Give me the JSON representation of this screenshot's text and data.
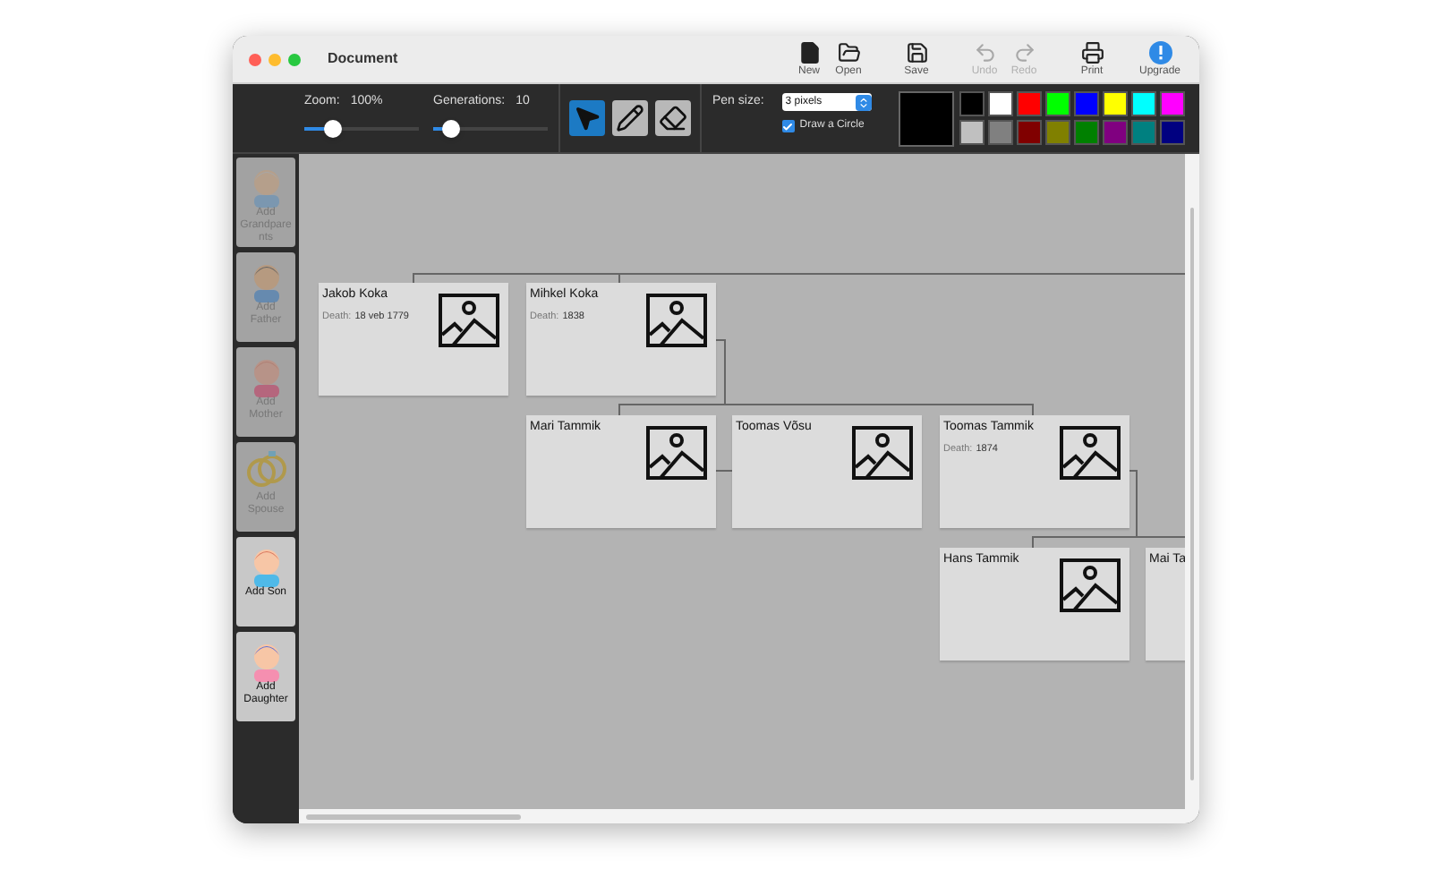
{
  "window": {
    "title": "Document"
  },
  "toolbar_buttons": [
    {
      "kind": "new",
      "label": "New",
      "disabled": false
    },
    {
      "kind": "open",
      "label": "Open",
      "disabled": false
    },
    {
      "kind": "save",
      "label": "Save",
      "disabled": false
    },
    {
      "kind": "undo",
      "label": "Undo",
      "disabled": true
    },
    {
      "kind": "redo",
      "label": "Redo",
      "disabled": true
    },
    {
      "kind": "print",
      "label": "Print",
      "disabled": false
    },
    {
      "kind": "upgrade",
      "label": "Upgrade",
      "disabled": false
    }
  ],
  "sliders": [
    {
      "label": "Zoom:",
      "reading": "100%",
      "level": 0.25
    },
    {
      "label": "Generations:",
      "reading": "10",
      "level": 0.15
    }
  ],
  "tools": [
    {
      "kind": "pointer",
      "selected": true
    },
    {
      "kind": "pencil",
      "selected": false
    },
    {
      "kind": "eraser",
      "selected": false
    }
  ],
  "pen_size": {
    "label": "Pen size:",
    "value": "3 pixels"
  },
  "draw_circle": {
    "label": "Draw a Circle",
    "checked": true
  },
  "current_swatch": {
    "color": "#000000"
  },
  "palette": [
    {
      "color": "#000000"
    },
    {
      "color": "#ffffff"
    },
    {
      "color": "#ff0000"
    },
    {
      "color": "#00ff00"
    },
    {
      "color": "#0000ff"
    },
    {
      "color": "#ffff00"
    },
    {
      "color": "#00ffff"
    },
    {
      "color": "#ff00ff"
    },
    {
      "color": "#c0c0c0"
    },
    {
      "color": "#808080"
    },
    {
      "color": "#800000"
    },
    {
      "color": "#808000"
    },
    {
      "color": "#008000"
    },
    {
      "color": "#800080"
    },
    {
      "color": "#008080"
    },
    {
      "color": "#000080"
    }
  ],
  "sidebar": [
    {
      "kind": "grandparents",
      "label": "Add Grandparents",
      "disabled": true
    },
    {
      "kind": "father",
      "label": "Add Father",
      "disabled": true
    },
    {
      "kind": "mother",
      "label": "Add Mother",
      "disabled": true
    },
    {
      "kind": "spouse",
      "label": "Add Spouse",
      "disabled": true
    },
    {
      "kind": "son",
      "label": "Add Son",
      "disabled": false
    },
    {
      "kind": "daughter",
      "label": "Add Daughter",
      "disabled": false
    }
  ],
  "people": [
    {
      "name": "Jakob Koka",
      "death_label": "Death:",
      "death": "18 veb 1779"
    },
    {
      "name": "Mihkel Koka",
      "death_label": "Death:",
      "death": "1838"
    },
    {
      "name": "Mari Tammik"
    },
    {
      "name": "Toomas Võsu"
    },
    {
      "name": "Toomas Tammik",
      "death_label": "Death:",
      "death": "1874"
    },
    {
      "name": "Hans Tammik"
    },
    {
      "name": "Mai Ta"
    }
  ]
}
